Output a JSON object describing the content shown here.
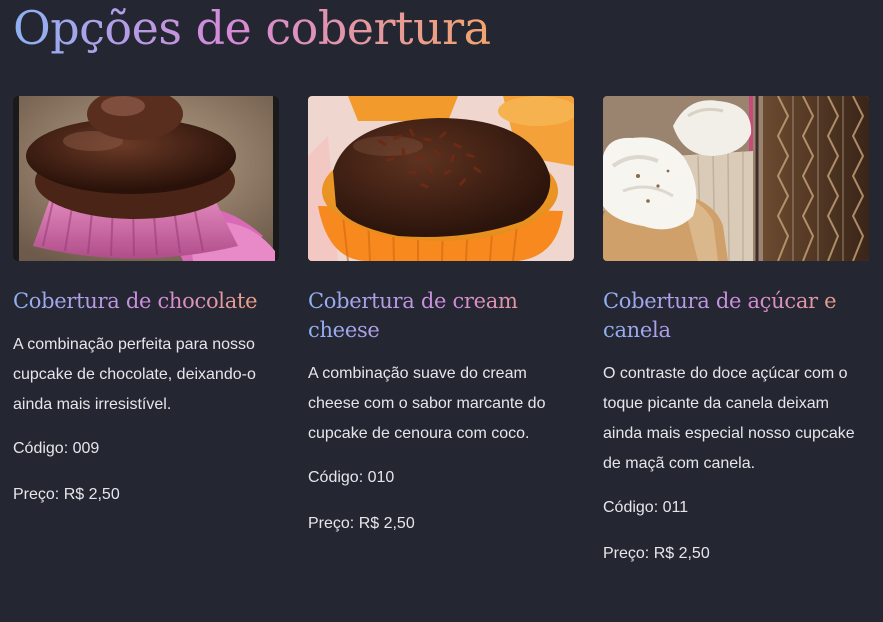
{
  "page": {
    "title": "Opções de cobertura"
  },
  "products": [
    {
      "image": "chocolate-cupcake-photo",
      "name": "Cobertura de chocolate",
      "description": "A combinação perfeita para nosso cupcake de chocolate, deixando-o ainda mais irresistível.",
      "code": "Código: 009",
      "price": "Preço: R$ 2,50"
    },
    {
      "image": "cream-cheese-cupcake-photo",
      "name": "Cobertura de cream cheese",
      "description": "A combinação suave do cream cheese com o sabor marcante do cupcake de cenoura com coco.",
      "code": "Código: 010",
      "price": "Preço: R$ 2,50"
    },
    {
      "image": "sugar-cinnamon-cupcake-photo",
      "name": "Cobertura de açúcar e canela",
      "description": "O contraste do doce açúcar com o toque picante da canela deixam ainda mais especial nosso cupcake de maçã com canela.",
      "code": "Código: 011",
      "price": "Preço: R$ 2,50"
    }
  ],
  "colors": {
    "background": "#242732",
    "title_gradient": [
      "#8fb1f3",
      "#d58ad9",
      "#f2a46e"
    ],
    "text": "#e6e6ea"
  }
}
